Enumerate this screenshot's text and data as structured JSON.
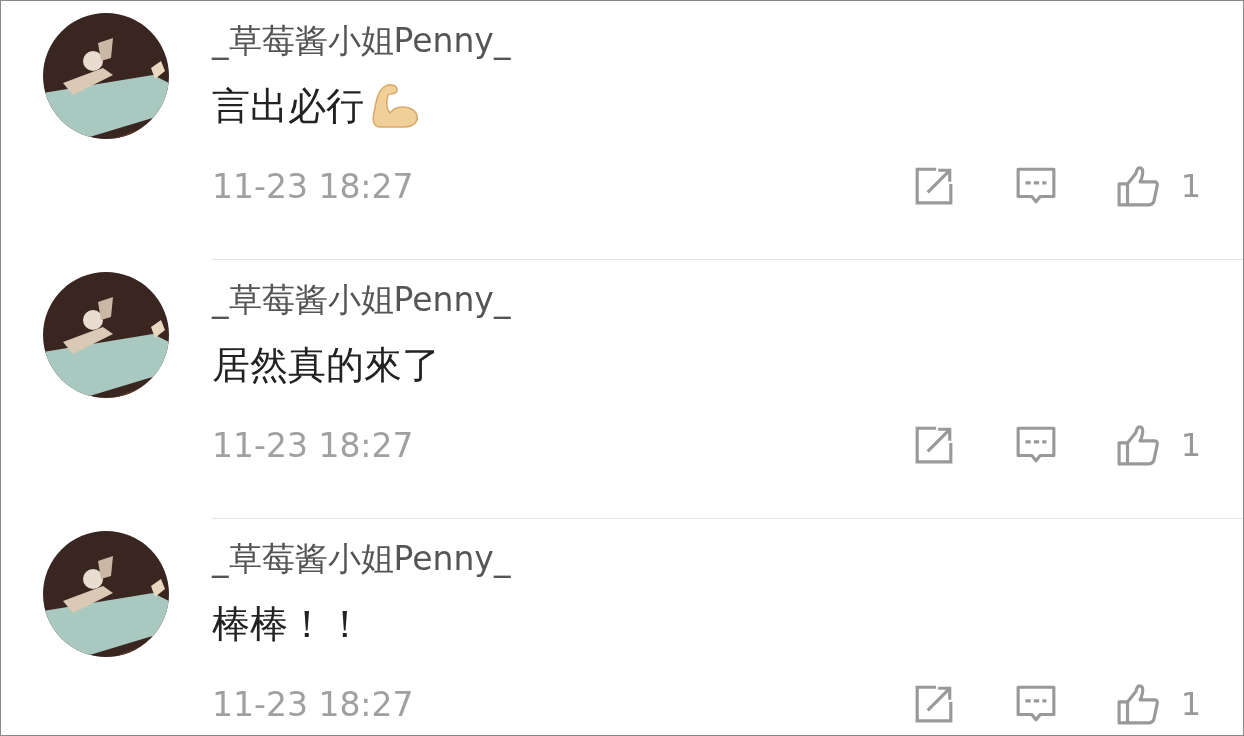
{
  "comments": [
    {
      "username": "_草莓酱小姐Penny_",
      "text": "言出必行",
      "emoji": true,
      "time": "11-23 18:27",
      "likes": "1"
    },
    {
      "username": "_草莓酱小姐Penny_",
      "text": "居然真的來了",
      "time": "11-23 18:27",
      "likes": "1"
    },
    {
      "username": "_草莓酱小姐Penny_",
      "text": "棒棒！！",
      "time": "11-23 18:27",
      "likes": "1"
    }
  ]
}
